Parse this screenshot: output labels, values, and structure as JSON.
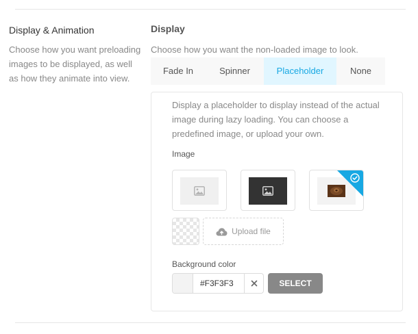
{
  "section": {
    "title": "Display & Animation",
    "description": "Choose how you want preloading images to be displayed, as well as how they animate into view."
  },
  "display": {
    "title": "Display",
    "description": "Choose how you want the non-loaded image to look.",
    "tabs": [
      {
        "label": "Fade In",
        "active": false
      },
      {
        "label": "Spinner",
        "active": false
      },
      {
        "label": "Placeholder",
        "active": true
      },
      {
        "label": "None",
        "active": false
      }
    ]
  },
  "placeholder": {
    "description": "Display a placeholder to display instead of the actual image during lazy loading. You can choose a predefined image, or upload your own.",
    "image_label": "Image",
    "images": [
      {
        "icon": "image-icon",
        "style": "light",
        "selected": false
      },
      {
        "icon": "image-icon",
        "style": "dark",
        "selected": false
      },
      {
        "icon": "custom-photo",
        "style": "custom",
        "selected": true
      }
    ],
    "upload_label": "Upload file",
    "bg_label": "Background color",
    "bg_value": "#F3F3F3",
    "select_label": "SELECT"
  },
  "colors": {
    "accent": "#17a8e3",
    "active_tab_bg": "#e1f6ff",
    "select_button": "#888888",
    "swatch": "#f3f3f3"
  }
}
